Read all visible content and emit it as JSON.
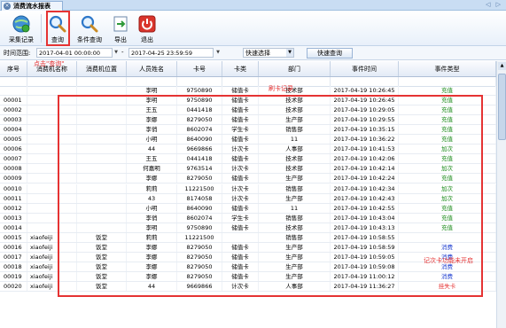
{
  "window": {
    "tab_title": "消费流水报表",
    "close_glyph": "×",
    "nav_arrows": "◁ ▷"
  },
  "toolbar": {
    "buttons": [
      {
        "label": "采集记录",
        "icon": "globe-refresh-icon"
      },
      {
        "label": "查询",
        "icon": "magnifier-icon"
      },
      {
        "label": "条件查询",
        "icon": "magnifier-filter-icon"
      },
      {
        "label": "导出",
        "icon": "export-icon"
      },
      {
        "label": "退出",
        "icon": "power-icon"
      }
    ]
  },
  "filter": {
    "label": "时间范围:",
    "start": "2017-04-01 00:00:00",
    "end": "2017-04-25 23:59:59",
    "dash": "-",
    "quick_select": "快速选择",
    "quick_query": "快速查询"
  },
  "annotations": {
    "click_query": "点击\"查询\"",
    "swipe_records": "刷卡记录",
    "record_card_note": "记次卡功能未开启",
    "color": "#e53333"
  },
  "table": {
    "columns": [
      "序号",
      "消费机名称",
      "消费机位置",
      "人员姓名",
      "卡号",
      "卡类",
      "部门",
      "事件时间",
      "事件类型"
    ],
    "rows": [
      [
        "",
        "",
        "",
        "李明",
        "9750890",
        "储值卡",
        "技术部",
        "2017-04-19 10:26:45",
        "充值",
        "#1a8a1a"
      ],
      [
        "00001",
        "",
        "",
        "李明",
        "9750890",
        "储值卡",
        "技术部",
        "2017-04-19 10:26:45",
        "充值",
        "#1a8a1a"
      ],
      [
        "00002",
        "",
        "",
        "王五",
        "0441418",
        "储值卡",
        "技术部",
        "2017-04-19 10:29:05",
        "充值",
        "#1a8a1a"
      ],
      [
        "00003",
        "",
        "",
        "李娜",
        "8279050",
        "储值卡",
        "生产部",
        "2017-04-19 10:29:55",
        "充值",
        "#1a8a1a"
      ],
      [
        "00004",
        "",
        "",
        "李俏",
        "8602074",
        "学生卡",
        "销售部",
        "2017-04-19 10:35:15",
        "充值",
        "#1a8a1a"
      ],
      [
        "00005",
        "",
        "",
        "小明",
        "8640090",
        "储值卡",
        "11",
        "2017-04-19 10:36:22",
        "充值",
        "#1a8a1a"
      ],
      [
        "00006",
        "",
        "",
        "44",
        "9669866",
        "计次卡",
        "人事部",
        "2017-04-19 10:41:53",
        "加次",
        "#1a8a1a"
      ],
      [
        "00007",
        "",
        "",
        "王五",
        "0441418",
        "储值卡",
        "技术部",
        "2017-04-19 10:42:06",
        "充值",
        "#1a8a1a"
      ],
      [
        "00008",
        "",
        "",
        "何嘉明",
        "9763514",
        "计次卡",
        "技术部",
        "2017-04-19 10:42:14",
        "加次",
        "#1a8a1a"
      ],
      [
        "00009",
        "",
        "",
        "李娜",
        "8279050",
        "储值卡",
        "生产部",
        "2017-04-19 10:42:24",
        "充值",
        "#1a8a1a"
      ],
      [
        "00010",
        "",
        "",
        "莉莉",
        "11221500",
        "计次卡",
        "销售部",
        "2017-04-19 10:42:34",
        "加次",
        "#1a8a1a"
      ],
      [
        "00011",
        "",
        "",
        "43",
        "8174058",
        "计次卡",
        "生产部",
        "2017-04-19 10:42:43",
        "加次",
        "#1a8a1a"
      ],
      [
        "00012",
        "",
        "",
        "小明",
        "8640090",
        "储值卡",
        "11",
        "2017-04-19 10:42:55",
        "充值",
        "#1a8a1a"
      ],
      [
        "00013",
        "",
        "",
        "李俏",
        "8602074",
        "学生卡",
        "销售部",
        "2017-04-19 10:43:04",
        "充值",
        "#1a8a1a"
      ],
      [
        "00014",
        "",
        "",
        "李明",
        "9750890",
        "储值卡",
        "技术部",
        "2017-04-19 10:43:13",
        "充值",
        "#1a8a1a"
      ],
      [
        "00015",
        "xiaofeiji",
        "饭堂",
        "莉莉",
        "11221500",
        "",
        "销售部",
        "2017-04-19 10:58:55",
        "",
        "#1a8a1a"
      ],
      [
        "00016",
        "xiaofeiji",
        "饭堂",
        "李娜",
        "8279050",
        "储值卡",
        "生产部",
        "2017-04-19 10:58:59",
        "消费",
        "#1f3fd0"
      ],
      [
        "00017",
        "xiaofeiji",
        "饭堂",
        "李娜",
        "8279050",
        "储值卡",
        "生产部",
        "2017-04-19 10:59:05",
        "消费",
        "#1f3fd0"
      ],
      [
        "00018",
        "xiaofeiji",
        "饭堂",
        "李娜",
        "8279050",
        "储值卡",
        "生产部",
        "2017-04-19 10:59:08",
        "消费",
        "#1f3fd0"
      ],
      [
        "00019",
        "xiaofeiji",
        "饭堂",
        "李娜",
        "8279050",
        "储值卡",
        "生产部",
        "2017-04-19 11:00:12",
        "消费",
        "#1f3fd0"
      ],
      [
        "00020",
        "xiaofeiji",
        "饭堂",
        "44",
        "9669866",
        "计次卡",
        "人事部",
        "2017-04-19 11:36:27",
        "挂失卡",
        "#e53333"
      ]
    ]
  }
}
